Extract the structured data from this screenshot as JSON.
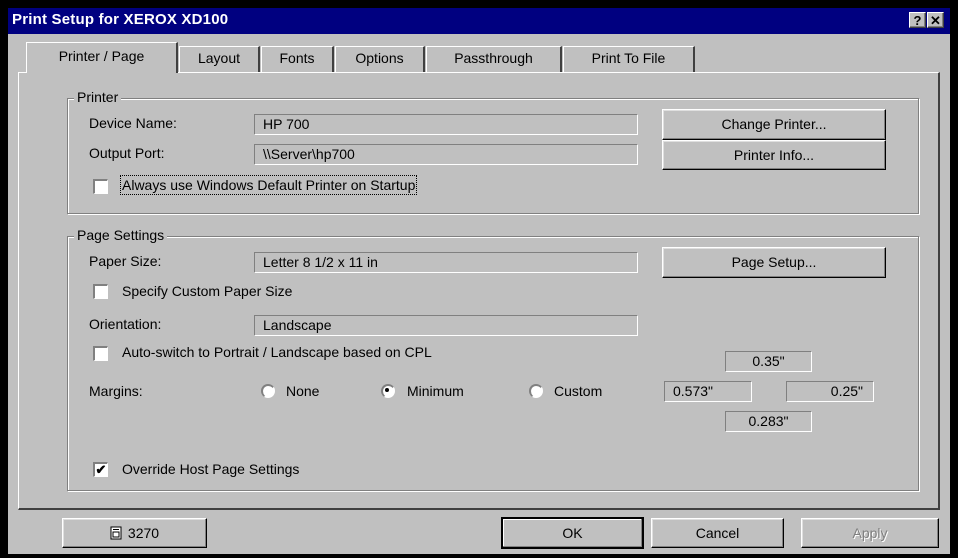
{
  "window": {
    "title": "Print Setup for XEROX XD100",
    "help_button": "?",
    "close_button": "✕"
  },
  "tabs": [
    {
      "label": "Printer / Page",
      "active": true
    },
    {
      "label": "Layout",
      "active": false
    },
    {
      "label": "Fonts",
      "active": false
    },
    {
      "label": "Options",
      "active": false
    },
    {
      "label": "Passthrough",
      "active": false
    },
    {
      "label": "Print To File",
      "active": false
    }
  ],
  "printer_group": {
    "legend": "Printer",
    "device_name_label": "Device Name:",
    "device_name_value": "HP 700",
    "output_port_label": "Output Port:",
    "output_port_value": "\\\\Server\\hp700",
    "change_printer_button": "Change Printer...",
    "printer_info_button": "Printer Info...",
    "default_printer_checkbox": {
      "label": "Always use Windows Default Printer on Startup",
      "checked": false
    }
  },
  "page_group": {
    "legend": "Page Settings",
    "paper_size_label": "Paper Size:",
    "paper_size_value": "Letter 8 1/2 x 11 in",
    "page_setup_button": "Page Setup...",
    "custom_paper_checkbox": {
      "label": "Specify Custom Paper Size",
      "checked": false
    },
    "orientation_label": "Orientation:",
    "orientation_value": "Landscape",
    "autoswitch_checkbox": {
      "label": "Auto-switch to Portrait / Landscape based on CPL",
      "checked": false
    },
    "margins_label": "Margins:",
    "margin_options": [
      {
        "label": "None",
        "selected": false
      },
      {
        "label": "Minimum",
        "selected": true
      },
      {
        "label": "Custom",
        "selected": false
      }
    ],
    "margin_top": "0.35\"",
    "margin_left": "0.573\"",
    "margin_right": "0.25\"",
    "margin_bottom": "0.283\"",
    "override_checkbox": {
      "label": "Override Host Page Settings",
      "checked": true
    }
  },
  "footer": {
    "code_button": "3270",
    "ok_button": "OK",
    "cancel_button": "Cancel",
    "apply_button": "Apply"
  },
  "icons": {
    "code_button_icon": "document-icon",
    "check_glyph": "✔"
  }
}
